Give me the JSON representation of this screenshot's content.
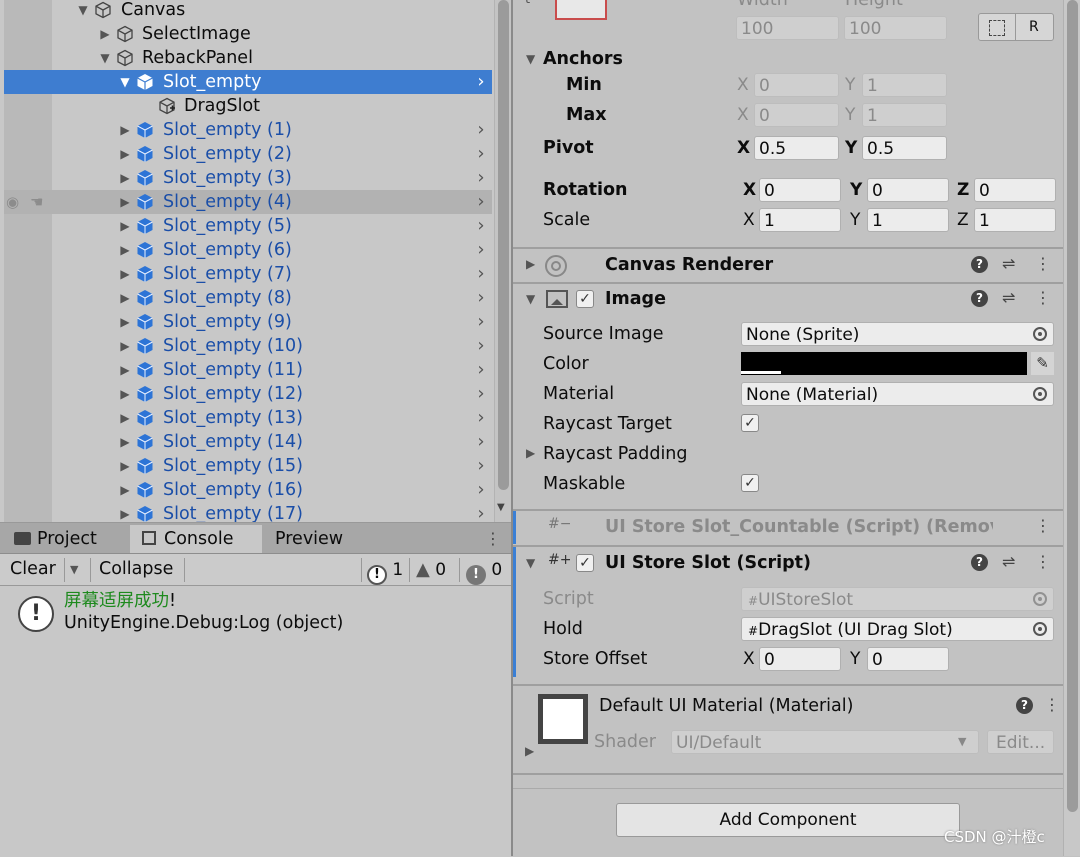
{
  "hierarchy": {
    "rows": [
      {
        "label": "Canvas",
        "expanded": true,
        "style": "normal"
      },
      {
        "label": "SelectImage",
        "expanded": false,
        "style": "normal"
      },
      {
        "label": "RebackPanel",
        "expanded": true,
        "style": "normal"
      },
      {
        "label": "Slot_empty",
        "expanded": true,
        "style": "selected"
      },
      {
        "label": "DragSlot",
        "expanded": null,
        "style": "normal"
      },
      {
        "label": "Slot_empty (1)",
        "style": "prefab"
      },
      {
        "label": "Slot_empty (2)",
        "style": "prefab"
      },
      {
        "label": "Slot_empty (3)",
        "style": "prefab"
      },
      {
        "label": "Slot_empty (4)",
        "style": "prefab-hover"
      },
      {
        "label": "Slot_empty (5)",
        "style": "prefab"
      },
      {
        "label": "Slot_empty (6)",
        "style": "prefab"
      },
      {
        "label": "Slot_empty (7)",
        "style": "prefab"
      },
      {
        "label": "Slot_empty (8)",
        "style": "prefab"
      },
      {
        "label": "Slot_empty (9)",
        "style": "prefab"
      },
      {
        "label": "Slot_empty (10)",
        "style": "prefab"
      },
      {
        "label": "Slot_empty (11)",
        "style": "prefab"
      },
      {
        "label": "Slot_empty (12)",
        "style": "prefab"
      },
      {
        "label": "Slot_empty (13)",
        "style": "prefab"
      },
      {
        "label": "Slot_empty (14)",
        "style": "prefab"
      },
      {
        "label": "Slot_empty (15)",
        "style": "prefab"
      },
      {
        "label": "Slot_empty (16)",
        "style": "prefab"
      },
      {
        "label": "Slot_empty (17)",
        "style": "prefab"
      }
    ]
  },
  "console": {
    "tabs": [
      "Project",
      "Console",
      "Preview"
    ],
    "toolbar": {
      "clear": "Clear",
      "collapse": "Collapse"
    },
    "counts": {
      "info": "1",
      "warning": "0",
      "error": "0"
    },
    "entry": {
      "line1": "屏幕适屏成功",
      "line1_suffix": "!",
      "line2": "UnityEngine.Debug:Log (object)"
    }
  },
  "inspector": {
    "rect": {
      "width_label": "Width",
      "height_label": "Height",
      "width": "100",
      "height": "100",
      "r_button": "R",
      "anchors_label": "Anchors",
      "min_label": "Min",
      "max_label": "Max",
      "min_x": "0",
      "min_y": "1",
      "max_x": "0",
      "max_y": "1",
      "pivot_label": "Pivot",
      "pivot_x": "0.5",
      "pivot_y": "0.5",
      "rotation_label": "Rotation",
      "rot_x": "0",
      "rot_y": "0",
      "rot_z": "0",
      "scale_label": "Scale",
      "scale_x": "1",
      "scale_y": "1",
      "scale_z": "1",
      "axis_x": "X",
      "axis_y": "Y",
      "axis_z": "Z"
    },
    "canvas_renderer": {
      "title": "Canvas Renderer"
    },
    "image": {
      "title": "Image",
      "source_image_label": "Source Image",
      "source_image": "None (Sprite)",
      "color_label": "Color",
      "color_value": "#000000",
      "material_label": "Material",
      "material": "None (Material)",
      "raycast_target_label": "Raycast Target",
      "raycast_padding_label": "Raycast Padding",
      "maskable_label": "Maskable"
    },
    "removed_script": {
      "title": "UI Store Slot_Countable (Script) (Removed"
    },
    "store_slot": {
      "title": "UI Store Slot (Script)",
      "script_label": "Script",
      "script": "UIStoreSlot",
      "hold_label": "Hold",
      "hold": "DragSlot (UI Drag Slot)",
      "offset_label": "Store Offset",
      "offset_x": "0",
      "offset_y": "0"
    },
    "material_preview": {
      "title": "Default UI Material (Material)",
      "shader_label": "Shader",
      "shader": "UI/Default",
      "edit": "Edit..."
    },
    "add_component": "Add Component"
  },
  "watermark": "CSDN @汁橙c",
  "colors": {
    "selection": "#3e7dd0",
    "prefab_text": "#1a4ea8",
    "log_green": "#1e8a1e"
  }
}
